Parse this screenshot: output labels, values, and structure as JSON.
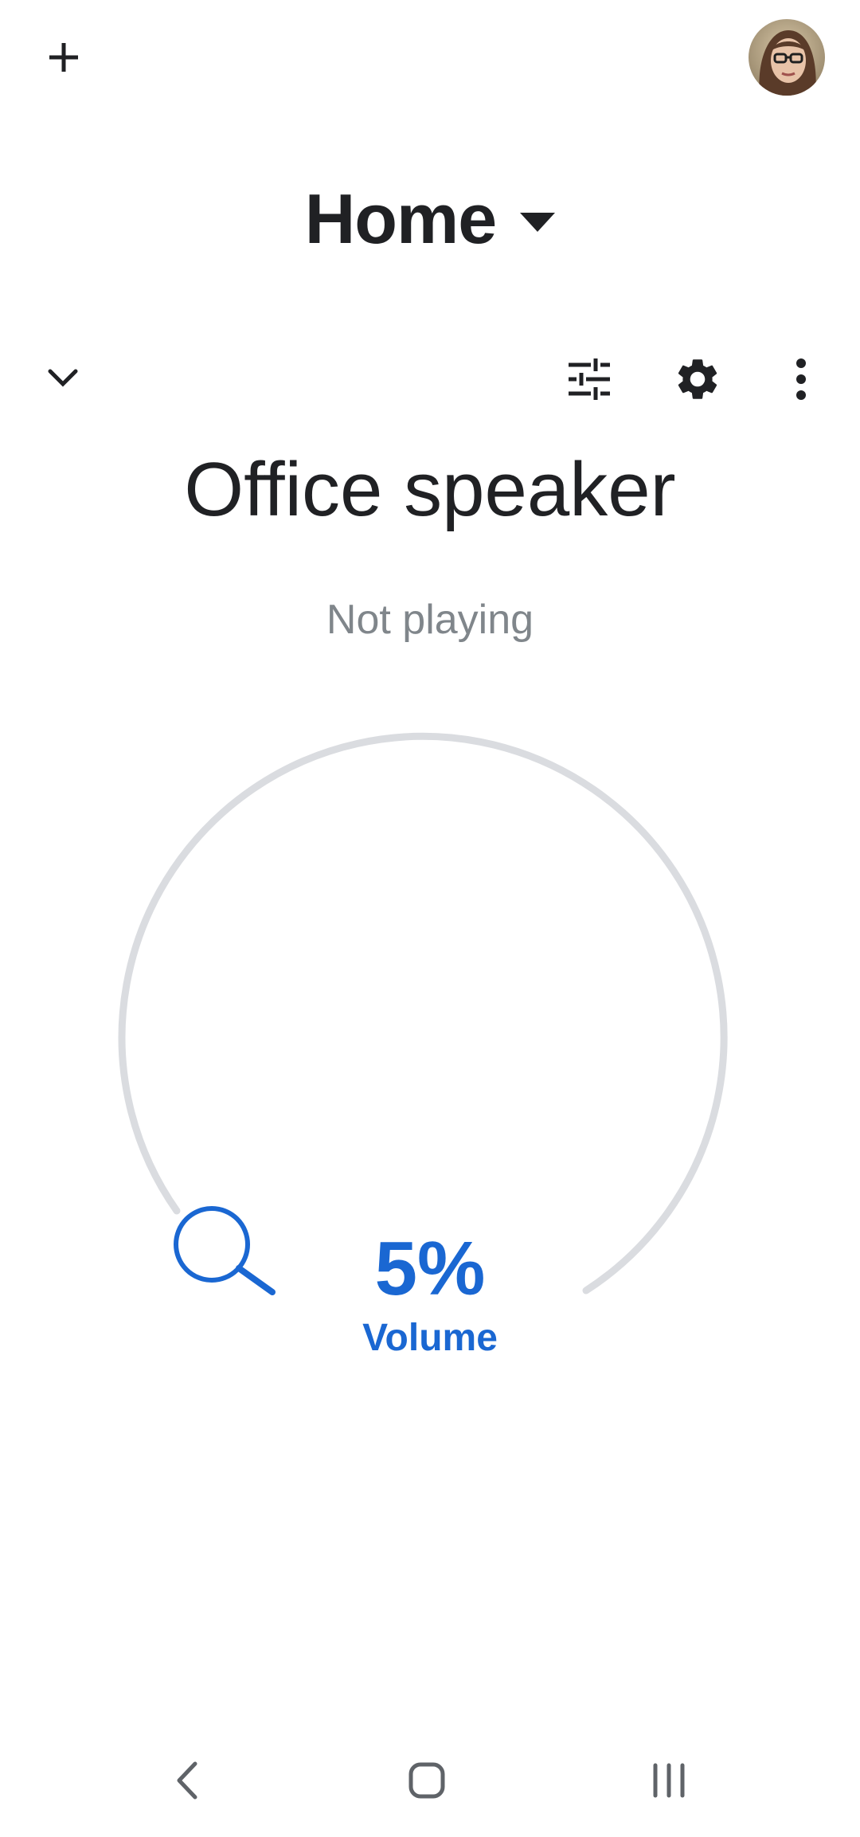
{
  "header": {
    "add_icon": "plus-icon",
    "avatar_icon": "user-avatar"
  },
  "home": {
    "title": "Home",
    "caret_icon": "dropdown-caret-icon"
  },
  "device_toolbar": {
    "collapse_icon": "chevron-down-icon",
    "equalizer_icon": "equalizer-icon",
    "settings_icon": "gear-icon",
    "more_icon": "more-vert-icon"
  },
  "device": {
    "name": "Office speaker",
    "status": "Not playing"
  },
  "volume": {
    "value_text": "5%",
    "level": 0.05,
    "label": "Volume",
    "accent_color": "#1a67d2",
    "track_color": "#dadce0"
  },
  "navbar": {
    "back_icon": "back-icon",
    "home_icon": "home-icon",
    "recents_icon": "recents-icon"
  }
}
